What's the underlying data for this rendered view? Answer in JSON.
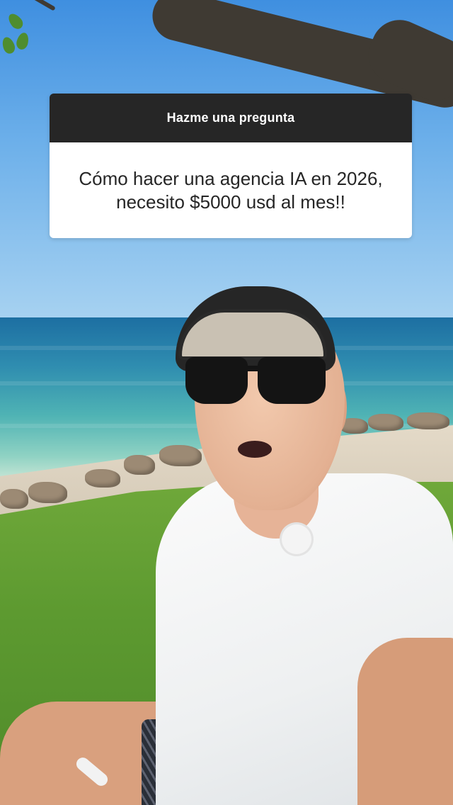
{
  "question_sticker": {
    "title": "Hazme una pregunta",
    "question_lines": [
      "Cómo hacer una agencia IA en 2026,",
      "necesito $5000 usd al mes!!"
    ],
    "header_color": "#262626",
    "body_color": "#ffffff"
  },
  "scene": {
    "subject": "man-in-cap-and-sunglasses",
    "icons": [
      "lavalier-mic-icon"
    ]
  }
}
